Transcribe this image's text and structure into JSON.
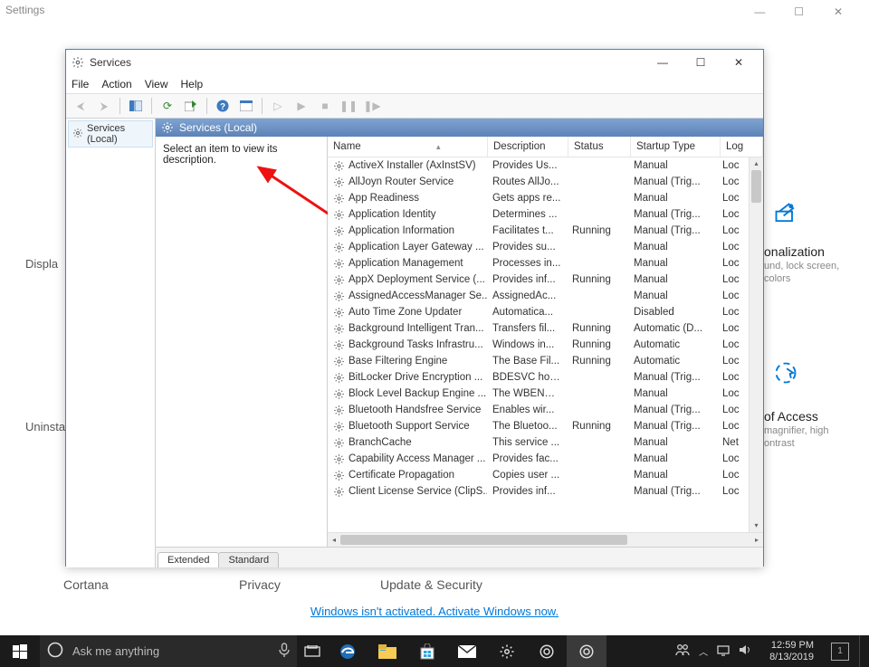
{
  "settings": {
    "title": "Settings",
    "labels": {
      "display": "Displa",
      "uninstall": "Uninstall,",
      "cortana": "Cortana",
      "privacy": "Privacy",
      "update": "Update & Security"
    },
    "personalization": {
      "title": "onalization",
      "sub1": "und, lock screen,",
      "sub2": "colors"
    },
    "ease": {
      "title": "of Access",
      "sub1": "magnifier, high",
      "sub2": "ontrast"
    },
    "activate_link": "Windows isn't activated. Activate Windows now."
  },
  "services": {
    "window_title": "Services",
    "menu": {
      "file": "File",
      "action": "Action",
      "view": "View",
      "help": "Help"
    },
    "nav_item": "Services (Local)",
    "header": "Services (Local)",
    "desc_prompt": "Select an item to view its description.",
    "columns": {
      "name": "Name",
      "description": "Description",
      "status": "Status",
      "startup": "Startup Type",
      "logon": "Log"
    },
    "tabs": {
      "extended": "Extended",
      "standard": "Standard"
    },
    "rows": [
      {
        "name": "ActiveX Installer (AxInstSV)",
        "desc": "Provides Us...",
        "status": "",
        "startup": "Manual",
        "logon": "Loc"
      },
      {
        "name": "AllJoyn Router Service",
        "desc": "Routes AllJo...",
        "status": "",
        "startup": "Manual (Trig...",
        "logon": "Loc"
      },
      {
        "name": "App Readiness",
        "desc": "Gets apps re...",
        "status": "",
        "startup": "Manual",
        "logon": "Loc"
      },
      {
        "name": "Application Identity",
        "desc": "Determines ...",
        "status": "",
        "startup": "Manual (Trig...",
        "logon": "Loc"
      },
      {
        "name": "Application Information",
        "desc": "Facilitates t...",
        "status": "Running",
        "startup": "Manual (Trig...",
        "logon": "Loc"
      },
      {
        "name": "Application Layer Gateway ...",
        "desc": "Provides su...",
        "status": "",
        "startup": "Manual",
        "logon": "Loc"
      },
      {
        "name": "Application Management",
        "desc": "Processes in...",
        "status": "",
        "startup": "Manual",
        "logon": "Loc"
      },
      {
        "name": "AppX Deployment Service (...",
        "desc": "Provides inf...",
        "status": "Running",
        "startup": "Manual",
        "logon": "Loc"
      },
      {
        "name": "AssignedAccessManager Se...",
        "desc": "AssignedAc...",
        "status": "",
        "startup": "Manual",
        "logon": "Loc"
      },
      {
        "name": "Auto Time Zone Updater",
        "desc": "Automatica...",
        "status": "",
        "startup": "Disabled",
        "logon": "Loc"
      },
      {
        "name": "Background Intelligent Tran...",
        "desc": "Transfers fil...",
        "status": "Running",
        "startup": "Automatic (D...",
        "logon": "Loc"
      },
      {
        "name": "Background Tasks Infrastru...",
        "desc": "Windows in...",
        "status": "Running",
        "startup": "Automatic",
        "logon": "Loc"
      },
      {
        "name": "Base Filtering Engine",
        "desc": "The Base Fil...",
        "status": "Running",
        "startup": "Automatic",
        "logon": "Loc"
      },
      {
        "name": "BitLocker Drive Encryption ...",
        "desc": "BDESVC hos...",
        "status": "",
        "startup": "Manual (Trig...",
        "logon": "Loc"
      },
      {
        "name": "Block Level Backup Engine ...",
        "desc": "The WBENG...",
        "status": "",
        "startup": "Manual",
        "logon": "Loc"
      },
      {
        "name": "Bluetooth Handsfree Service",
        "desc": "Enables wir...",
        "status": "",
        "startup": "Manual (Trig...",
        "logon": "Loc"
      },
      {
        "name": "Bluetooth Support Service",
        "desc": "The Bluetoo...",
        "status": "Running",
        "startup": "Manual (Trig...",
        "logon": "Loc"
      },
      {
        "name": "BranchCache",
        "desc": "This service ...",
        "status": "",
        "startup": "Manual",
        "logon": "Net"
      },
      {
        "name": "Capability Access Manager ...",
        "desc": "Provides fac...",
        "status": "",
        "startup": "Manual",
        "logon": "Loc"
      },
      {
        "name": "Certificate Propagation",
        "desc": "Copies user ...",
        "status": "",
        "startup": "Manual",
        "logon": "Loc"
      },
      {
        "name": "Client License Service (ClipS...",
        "desc": "Provides inf...",
        "status": "",
        "startup": "Manual (Trig...",
        "logon": "Loc"
      }
    ]
  },
  "taskbar": {
    "search_placeholder": "Ask me anything",
    "time": "12:59 PM",
    "date": "8/13/2019",
    "notif_count": "1"
  }
}
